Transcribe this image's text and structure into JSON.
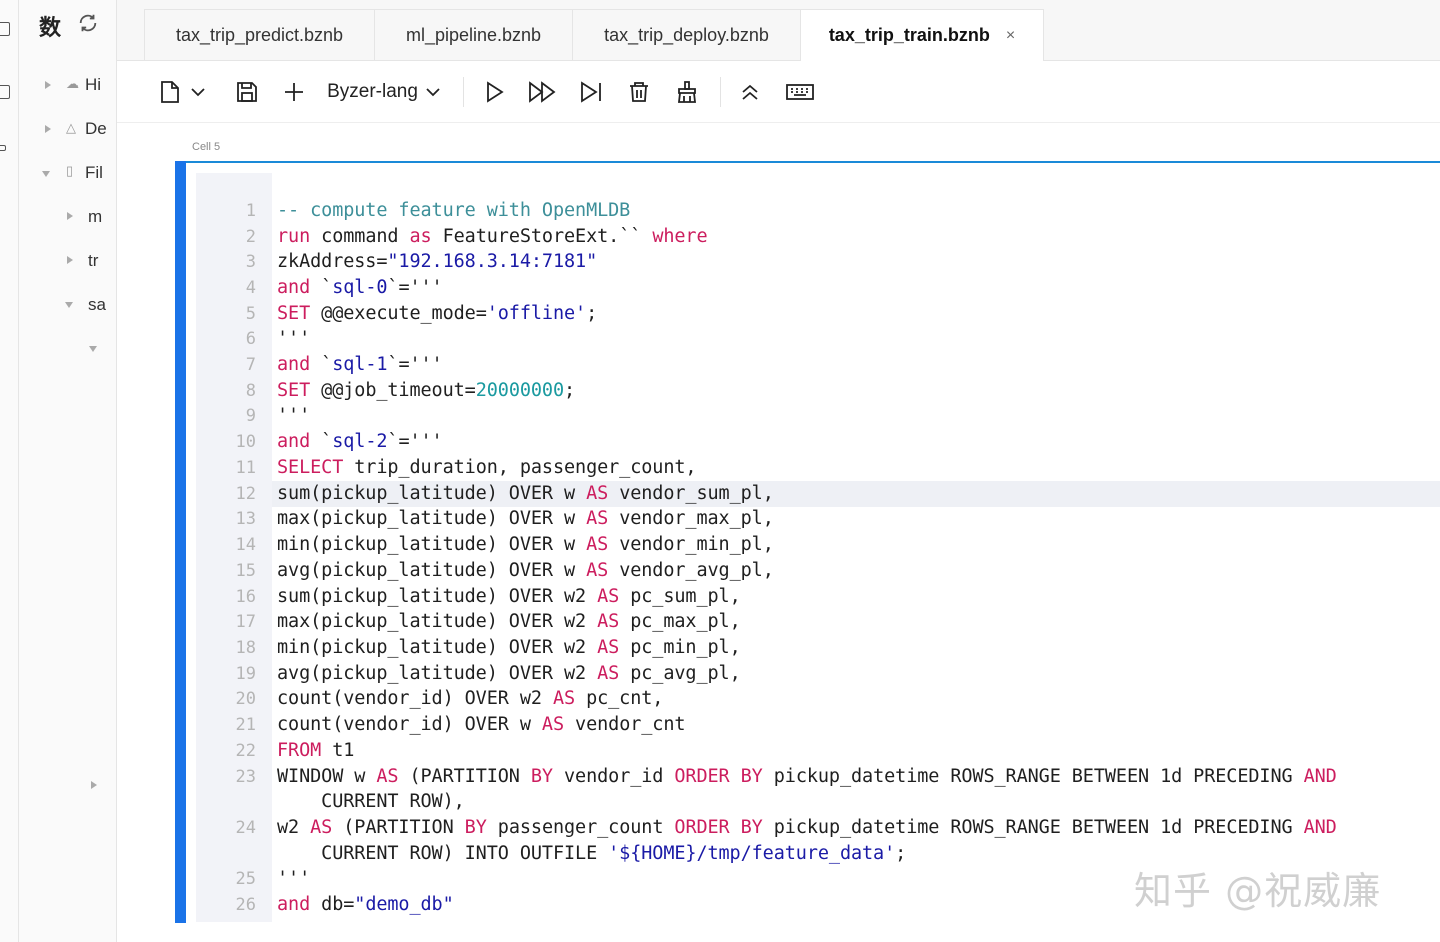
{
  "sidebar": {
    "title": "数",
    "items": [
      {
        "label": "Hi"
      },
      {
        "label": "De"
      },
      {
        "label": "Fil"
      },
      {
        "label": "m"
      },
      {
        "label": "tr"
      },
      {
        "label": "sa"
      }
    ]
  },
  "tabs": [
    {
      "label": "tax_trip_predict.bznb"
    },
    {
      "label": "ml_pipeline.bznb"
    },
    {
      "label": "tax_trip_deploy.bznb"
    },
    {
      "label": "tax_trip_train.bznb",
      "close": "×"
    }
  ],
  "toolbar": {
    "language": "Byzer-lang"
  },
  "cell": {
    "label": "Cell 5",
    "lines": [
      {
        "n": "1"
      },
      {
        "n": "2"
      },
      {
        "n": "3"
      },
      {
        "n": "4"
      },
      {
        "n": "5"
      },
      {
        "n": "6"
      },
      {
        "n": "7"
      },
      {
        "n": "8"
      },
      {
        "n": "9"
      },
      {
        "n": "10"
      },
      {
        "n": "11"
      },
      {
        "n": "12"
      },
      {
        "n": "13"
      },
      {
        "n": "14"
      },
      {
        "n": "15"
      },
      {
        "n": "16"
      },
      {
        "n": "17"
      },
      {
        "n": "18"
      },
      {
        "n": "19"
      },
      {
        "n": "20"
      },
      {
        "n": "21"
      },
      {
        "n": "22"
      },
      {
        "n": "23"
      },
      {
        "n": "24"
      },
      {
        "n": "25"
      },
      {
        "n": "26"
      }
    ],
    "code": {
      "l1": "-- compute feature with OpenMLDB",
      "l2_run": "run",
      "l2_a": " command ",
      "l2_as": "as",
      "l2_b": " FeatureStoreExt.`` ",
      "l2_where": "where",
      "l3_a": "zkAddress=",
      "l3_s": "\"192.168.3.14:7181\"",
      "l4_and": "and",
      "l4_a": " `",
      "l4_k": "sql-0",
      "l4_b": "`='''",
      "l5_set": "SET",
      "l5_a": " @@execute_mode=",
      "l5_s": "'offline'",
      "l5_b": ";",
      "l6": "'''",
      "l7_and": "and",
      "l7_a": " `",
      "l7_k": "sql-1",
      "l7_b": "`='''",
      "l8_set": "SET",
      "l8_a": " @@job_timeout=",
      "l8_n": "20000000",
      "l8_b": ";",
      "l9": "'''",
      "l10_and": "and",
      "l10_a": " `",
      "l10_k": "sql-2",
      "l10_b": "`='''",
      "l11_sel": "SELECT",
      "l11_a": " trip_duration, passenger_count,",
      "l12_a": "sum(pickup_latitude) OVER w ",
      "l12_as": "AS",
      "l12_b": " vendor_sum_pl,",
      "l13_a": "max(pickup_latitude) OVER w ",
      "l13_as": "AS",
      "l13_b": " vendor_max_pl,",
      "l14_a": "min(pickup_latitude) OVER w ",
      "l14_as": "AS",
      "l14_b": " vendor_min_pl,",
      "l15_a": "avg(pickup_latitude) OVER w ",
      "l15_as": "AS",
      "l15_b": " vendor_avg_pl,",
      "l16_a": "sum(pickup_latitude) OVER w2 ",
      "l16_as": "AS",
      "l16_b": " pc_sum_pl,",
      "l17_a": "max(pickup_latitude) OVER w2 ",
      "l17_as": "AS",
      "l17_b": " pc_max_pl,",
      "l18_a": "min(pickup_latitude) OVER w2 ",
      "l18_as": "AS",
      "l18_b": " pc_min_pl,",
      "l19_a": "avg(pickup_latitude) OVER w2 ",
      "l19_as": "AS",
      "l19_b": " pc_avg_pl,",
      "l20_a": "count(vendor_id) OVER w2 ",
      "l20_as": "AS",
      "l20_b": " pc_cnt,",
      "l21_a": "count(vendor_id) OVER w ",
      "l21_as": "AS",
      "l21_b": " vendor_cnt",
      "l22_from": "FROM",
      "l22_a": " t1",
      "l23_a": "WINDOW w ",
      "l23_as": "AS",
      "l23_b": " (PARTITION ",
      "l23_by1": "BY",
      "l23_c": " vendor_id ",
      "l23_ord": "ORDER BY",
      "l23_d": " pickup_datetime ROWS_RANGE BETWEEN 1d PRECEDING ",
      "l23_and": "AND",
      "l23w": "    CURRENT ROW),",
      "l24_a": "w2 ",
      "l24_as": "AS",
      "l24_b": " (PARTITION ",
      "l24_by1": "BY",
      "l24_c": " passenger_count ",
      "l24_ord": "ORDER BY",
      "l24_d": " pickup_datetime ROWS_RANGE BETWEEN 1d PRECEDING ",
      "l24_and": "AND",
      "l24w_a": "    CURRENT ROW) INTO OUTFILE ",
      "l24w_s": "'${HOME}/tmp/feature_data'",
      "l24w_b": ";",
      "l25": "'''",
      "l26_and": "and",
      "l26_a": " db=",
      "l26_s": "\"demo_db\""
    }
  },
  "watermark": "知乎 @祝威廉"
}
